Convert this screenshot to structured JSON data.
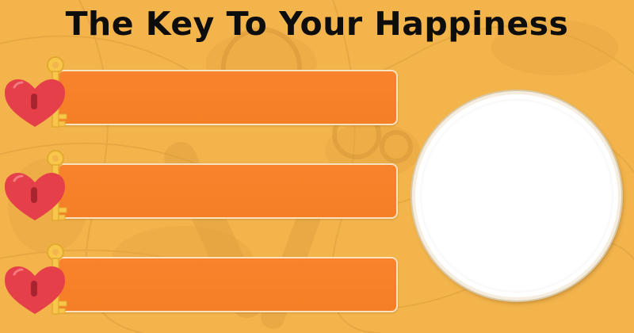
{
  "title": "The Key To Your Happiness",
  "theme": {
    "background": "#f3b44c",
    "bar_color": "#f7812a",
    "heart_color": "#e5404a",
    "key_color": "#f7c64b",
    "circle_color": "#ffffff"
  },
  "items": [
    {
      "icon": "heart-key-icon",
      "text": ""
    },
    {
      "icon": "heart-key-icon",
      "text": ""
    },
    {
      "icon": "heart-key-icon",
      "text": ""
    }
  ],
  "image_placeholder": {
    "shape": "circle"
  }
}
